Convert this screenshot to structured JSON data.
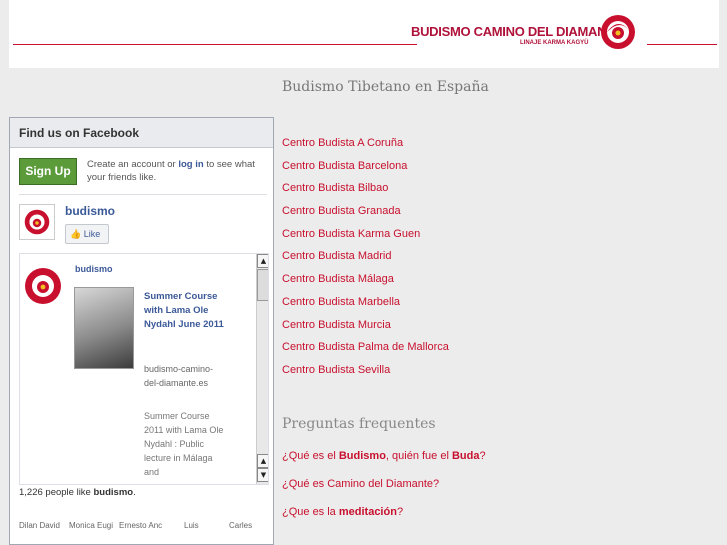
{
  "header": {
    "brand": "BUDISMO CAMINO DEL DIAMANTE",
    "brand_sub": "LINAJE KARMA KAGYÜ",
    "accent_color": "#c8102e"
  },
  "site_title": "Budismo Tibetano en España",
  "facebook": {
    "box_title": "Find us on Facebook",
    "signup_label": "Sign Up",
    "signup_text_pre": "Create an account or ",
    "signup_login": "log in",
    "signup_text_post": " to see what your friends like.",
    "page_name": "budismo",
    "like_label": "Like",
    "post": {
      "author": "budismo",
      "link_title": "Summer Course with Lama Ole Nydahl June 2011",
      "domain": "budismo-camino-del-diamante.es",
      "description": "Summer Course 2011 with Lama Ole Nydahl : Public lecture in Málaga and"
    },
    "likes_count": "1,226",
    "likes_text": " people like ",
    "likes_page": "budismo",
    "likes_end": ".",
    "friends": [
      "Dilan David",
      "Monica Eugi",
      "Ernesto Anc",
      "Luis",
      "Carles"
    ]
  },
  "centers": [
    "Centro Budista A Coruña",
    "Centro Budista Barcelona",
    "Centro Budista Bilbao",
    "Centro Budista Granada",
    "Centro Budista Karma Guen",
    "Centro Budista Madrid",
    "Centro Budista Málaga",
    "Centro Budista Marbella",
    "Centro Budista Murcia",
    "Centro Budista Palma de Mallorca",
    "Centro Budista Sevilla"
  ],
  "faq": {
    "title": "Preguntas frequentes",
    "q1_pre": "¿Qué es el ",
    "q1_b1": "Budismo",
    "q1_mid": ", quién fue el ",
    "q1_b2": "Buda",
    "q1_end": "?",
    "q2": "¿Qué es Camino del Diamante?",
    "q3_pre": "¿Que es la ",
    "q3_b": "meditación",
    "q3_end": "?"
  }
}
